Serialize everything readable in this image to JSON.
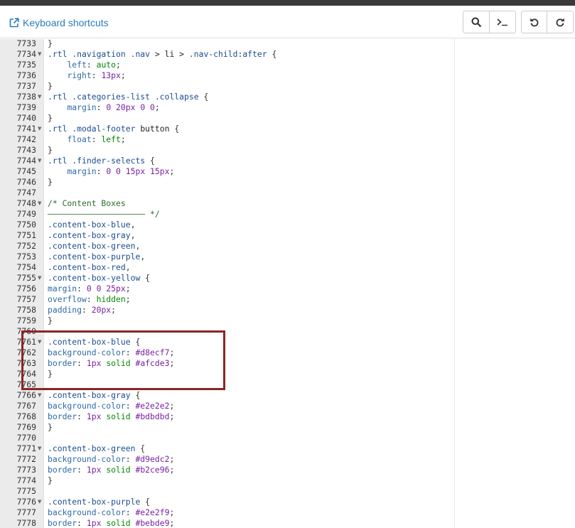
{
  "header": {
    "shortcuts_label": "Keyboard shortcuts",
    "link_color": "#2a7bbf"
  },
  "toolbar": {
    "search_icon": "search-icon",
    "console_icon": "terminal-icon",
    "undo_icon": "undo-icon",
    "redo_icon": "redo-icon"
  },
  "highlight_color": "#8b2525",
  "code_lines": [
    {
      "n": "7733",
      "fold": false,
      "tokens": [
        [
          "punc",
          "}"
        ]
      ]
    },
    {
      "n": "7734",
      "fold": true,
      "tokens": [
        [
          "sel",
          ".rtl .navigation .nav "
        ],
        [
          "tag",
          "> li > "
        ],
        [
          "sel",
          ".nav-child"
        ],
        [
          "punc",
          ":"
        ],
        [
          "sel",
          "after"
        ],
        [
          "punc",
          " {"
        ]
      ]
    },
    {
      "n": "7735",
      "fold": false,
      "tokens": [
        [
          "punc",
          "    "
        ],
        [
          "prop",
          "left"
        ],
        [
          "punc",
          ": "
        ],
        [
          "val",
          "auto"
        ],
        [
          "punc",
          ";"
        ]
      ]
    },
    {
      "n": "7736",
      "fold": false,
      "tokens": [
        [
          "punc",
          "    "
        ],
        [
          "prop",
          "right"
        ],
        [
          "punc",
          ": "
        ],
        [
          "num",
          "13px"
        ],
        [
          "punc",
          ";"
        ]
      ]
    },
    {
      "n": "7737",
      "fold": false,
      "tokens": [
        [
          "punc",
          "}"
        ]
      ]
    },
    {
      "n": "7738",
      "fold": true,
      "tokens": [
        [
          "sel",
          ".rtl .categories-list .collapse"
        ],
        [
          "punc",
          " {"
        ]
      ]
    },
    {
      "n": "7739",
      "fold": false,
      "tokens": [
        [
          "punc",
          "    "
        ],
        [
          "prop",
          "margin"
        ],
        [
          "punc",
          ": "
        ],
        [
          "num",
          "0 20px 0 0"
        ],
        [
          "punc",
          ";"
        ]
      ]
    },
    {
      "n": "7740",
      "fold": false,
      "tokens": [
        [
          "punc",
          "}"
        ]
      ]
    },
    {
      "n": "7741",
      "fold": true,
      "tokens": [
        [
          "sel",
          ".rtl .modal-footer "
        ],
        [
          "tag",
          "button"
        ],
        [
          "punc",
          " {"
        ]
      ]
    },
    {
      "n": "7742",
      "fold": false,
      "tokens": [
        [
          "punc",
          "    "
        ],
        [
          "prop",
          "float"
        ],
        [
          "punc",
          ": "
        ],
        [
          "val",
          "left"
        ],
        [
          "punc",
          ";"
        ]
      ]
    },
    {
      "n": "7743",
      "fold": false,
      "tokens": [
        [
          "punc",
          "}"
        ]
      ]
    },
    {
      "n": "7744",
      "fold": true,
      "tokens": [
        [
          "sel",
          ".rtl .finder-selects"
        ],
        [
          "punc",
          " {"
        ]
      ]
    },
    {
      "n": "7745",
      "fold": false,
      "tokens": [
        [
          "punc",
          "    "
        ],
        [
          "prop",
          "margin"
        ],
        [
          "punc",
          ": "
        ],
        [
          "num",
          "0 0 15px 15px"
        ],
        [
          "punc",
          ";"
        ]
      ]
    },
    {
      "n": "7746",
      "fold": false,
      "tokens": [
        [
          "punc",
          "}"
        ]
      ]
    },
    {
      "n": "7747",
      "fold": false,
      "tokens": []
    },
    {
      "n": "7748",
      "fold": true,
      "tokens": [
        [
          "com",
          "/* Content Boxes"
        ]
      ]
    },
    {
      "n": "7749",
      "fold": false,
      "tokens": [
        [
          "com",
          "———————————————————— */"
        ]
      ]
    },
    {
      "n": "7750",
      "fold": false,
      "tokens": [
        [
          "sel",
          ".content-box-blue"
        ],
        [
          "punc",
          ","
        ]
      ]
    },
    {
      "n": "7751",
      "fold": false,
      "tokens": [
        [
          "sel",
          ".content-box-gray"
        ],
        [
          "punc",
          ","
        ]
      ]
    },
    {
      "n": "7752",
      "fold": false,
      "tokens": [
        [
          "sel",
          ".content-box-green"
        ],
        [
          "punc",
          ","
        ]
      ]
    },
    {
      "n": "7753",
      "fold": false,
      "tokens": [
        [
          "sel",
          ".content-box-purple"
        ],
        [
          "punc",
          ","
        ]
      ]
    },
    {
      "n": "7754",
      "fold": false,
      "tokens": [
        [
          "sel",
          ".content-box-red"
        ],
        [
          "punc",
          ","
        ]
      ]
    },
    {
      "n": "7755",
      "fold": true,
      "tokens": [
        [
          "sel",
          ".content-box-yellow"
        ],
        [
          "punc",
          " {"
        ]
      ]
    },
    {
      "n": "7756",
      "fold": false,
      "tokens": [
        [
          "prop",
          "margin"
        ],
        [
          "punc",
          ": "
        ],
        [
          "num",
          "0 0 25px"
        ],
        [
          "punc",
          ";"
        ]
      ]
    },
    {
      "n": "7757",
      "fold": false,
      "tokens": [
        [
          "prop",
          "overflow"
        ],
        [
          "punc",
          ": "
        ],
        [
          "val",
          "hidden"
        ],
        [
          "punc",
          ";"
        ]
      ]
    },
    {
      "n": "7758",
      "fold": false,
      "tokens": [
        [
          "prop",
          "padding"
        ],
        [
          "punc",
          ": "
        ],
        [
          "num",
          "20px"
        ],
        [
          "punc",
          ";"
        ]
      ]
    },
    {
      "n": "7759",
      "fold": false,
      "tokens": [
        [
          "punc",
          "}"
        ]
      ]
    },
    {
      "n": "7760",
      "fold": false,
      "tokens": []
    },
    {
      "n": "7761",
      "fold": true,
      "tokens": [
        [
          "sel",
          ".content-box-blue"
        ],
        [
          "punc",
          " {"
        ]
      ]
    },
    {
      "n": "7762",
      "fold": false,
      "tokens": [
        [
          "prop",
          "background-color"
        ],
        [
          "punc",
          ": "
        ],
        [
          "num",
          "#d8ecf7"
        ],
        [
          "punc",
          ";"
        ]
      ]
    },
    {
      "n": "7763",
      "fold": false,
      "tokens": [
        [
          "prop",
          "border"
        ],
        [
          "punc",
          ": "
        ],
        [
          "num",
          "1px "
        ],
        [
          "val",
          "solid "
        ],
        [
          "num",
          "#afcde3"
        ],
        [
          "punc",
          ";"
        ]
      ]
    },
    {
      "n": "7764",
      "fold": false,
      "tokens": [
        [
          "punc",
          "}"
        ]
      ]
    },
    {
      "n": "7765",
      "fold": false,
      "tokens": []
    },
    {
      "n": "7766",
      "fold": true,
      "tokens": [
        [
          "sel",
          ".content-box-gray"
        ],
        [
          "punc",
          " {"
        ]
      ]
    },
    {
      "n": "7767",
      "fold": false,
      "tokens": [
        [
          "prop",
          "background-color"
        ],
        [
          "punc",
          ": "
        ],
        [
          "num",
          "#e2e2e2"
        ],
        [
          "punc",
          ";"
        ]
      ]
    },
    {
      "n": "7768",
      "fold": false,
      "tokens": [
        [
          "prop",
          "border"
        ],
        [
          "punc",
          ": "
        ],
        [
          "num",
          "1px "
        ],
        [
          "val",
          "solid "
        ],
        [
          "num",
          "#bdbdbd"
        ],
        [
          "punc",
          ";"
        ]
      ]
    },
    {
      "n": "7769",
      "fold": false,
      "tokens": [
        [
          "punc",
          "}"
        ]
      ]
    },
    {
      "n": "7770",
      "fold": false,
      "tokens": []
    },
    {
      "n": "7771",
      "fold": true,
      "tokens": [
        [
          "sel",
          ".content-box-green"
        ],
        [
          "punc",
          " {"
        ]
      ]
    },
    {
      "n": "7772",
      "fold": false,
      "tokens": [
        [
          "prop",
          "background-color"
        ],
        [
          "punc",
          ": "
        ],
        [
          "num",
          "#d9edc2"
        ],
        [
          "punc",
          ";"
        ]
      ]
    },
    {
      "n": "7773",
      "fold": false,
      "tokens": [
        [
          "prop",
          "border"
        ],
        [
          "punc",
          ": "
        ],
        [
          "num",
          "1px "
        ],
        [
          "val",
          "solid "
        ],
        [
          "num",
          "#b2ce96"
        ],
        [
          "punc",
          ";"
        ]
      ]
    },
    {
      "n": "7774",
      "fold": false,
      "tokens": [
        [
          "punc",
          "}"
        ]
      ]
    },
    {
      "n": "7775",
      "fold": false,
      "tokens": []
    },
    {
      "n": "7776",
      "fold": true,
      "tokens": [
        [
          "sel",
          ".content-box-purple"
        ],
        [
          "punc",
          " {"
        ]
      ]
    },
    {
      "n": "7777",
      "fold": false,
      "tokens": [
        [
          "prop",
          "background-color"
        ],
        [
          "punc",
          ": "
        ],
        [
          "num",
          "#e2e2f9"
        ],
        [
          "punc",
          ";"
        ]
      ]
    },
    {
      "n": "7778",
      "fold": false,
      "tokens": [
        [
          "prop",
          "border"
        ],
        [
          "punc",
          ": "
        ],
        [
          "num",
          "1px "
        ],
        [
          "val",
          "solid "
        ],
        [
          "num",
          "#bebde9"
        ],
        [
          "punc",
          ";"
        ]
      ]
    }
  ]
}
